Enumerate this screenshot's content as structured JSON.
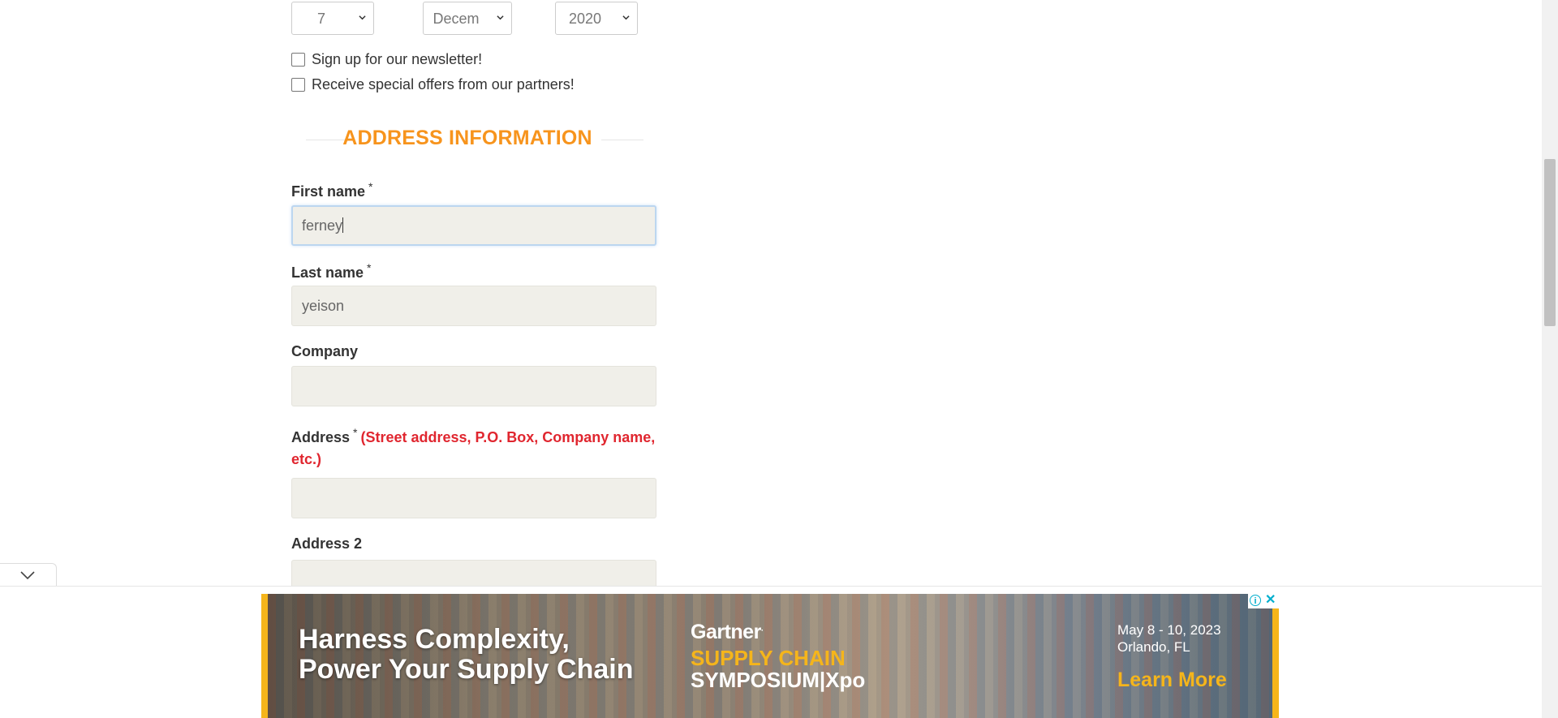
{
  "dob": {
    "day": "7",
    "month": "Decem",
    "year": "2020"
  },
  "checkboxes": {
    "newsletter": "Sign up for our newsletter!",
    "offers": "Receive special offers from our partners!"
  },
  "section": {
    "title": "ADDRESS INFORMATION"
  },
  "form": {
    "first_name": {
      "label": "First name",
      "required": "*",
      "value": "ferney"
    },
    "last_name": {
      "label": "Last name",
      "required": "*",
      "value": "yeison"
    },
    "company": {
      "label": "Company",
      "value": ""
    },
    "address": {
      "label": "Address",
      "required": "*",
      "hint_1": "(Street address, P.O. Box, Company name,",
      "hint_2": "etc.)",
      "value": ""
    },
    "address2": {
      "label": "Address 2",
      "value": ""
    }
  },
  "ad": {
    "headline_1": "Harness Complexity,",
    "headline_2": "Power Your Supply Chain",
    "brand": "Gartner",
    "event_1": "SUPPLY CHAIN",
    "event_2": "SYMPOSIUM|Xpo",
    "dates": "May 8 - 10, 2023",
    "location": "Orlando, FL",
    "cta": "Learn More",
    "accent_color": "#f5b51b"
  },
  "icons": {
    "select_chevron": "chevron-down-icon",
    "collapse": "chevron-down-icon",
    "ad_info": "info-icon",
    "ad_close": "close-icon"
  },
  "colors": {
    "section_title": "#f7941d",
    "hint": "#e0262f",
    "field_bg": "#f0efe9"
  }
}
